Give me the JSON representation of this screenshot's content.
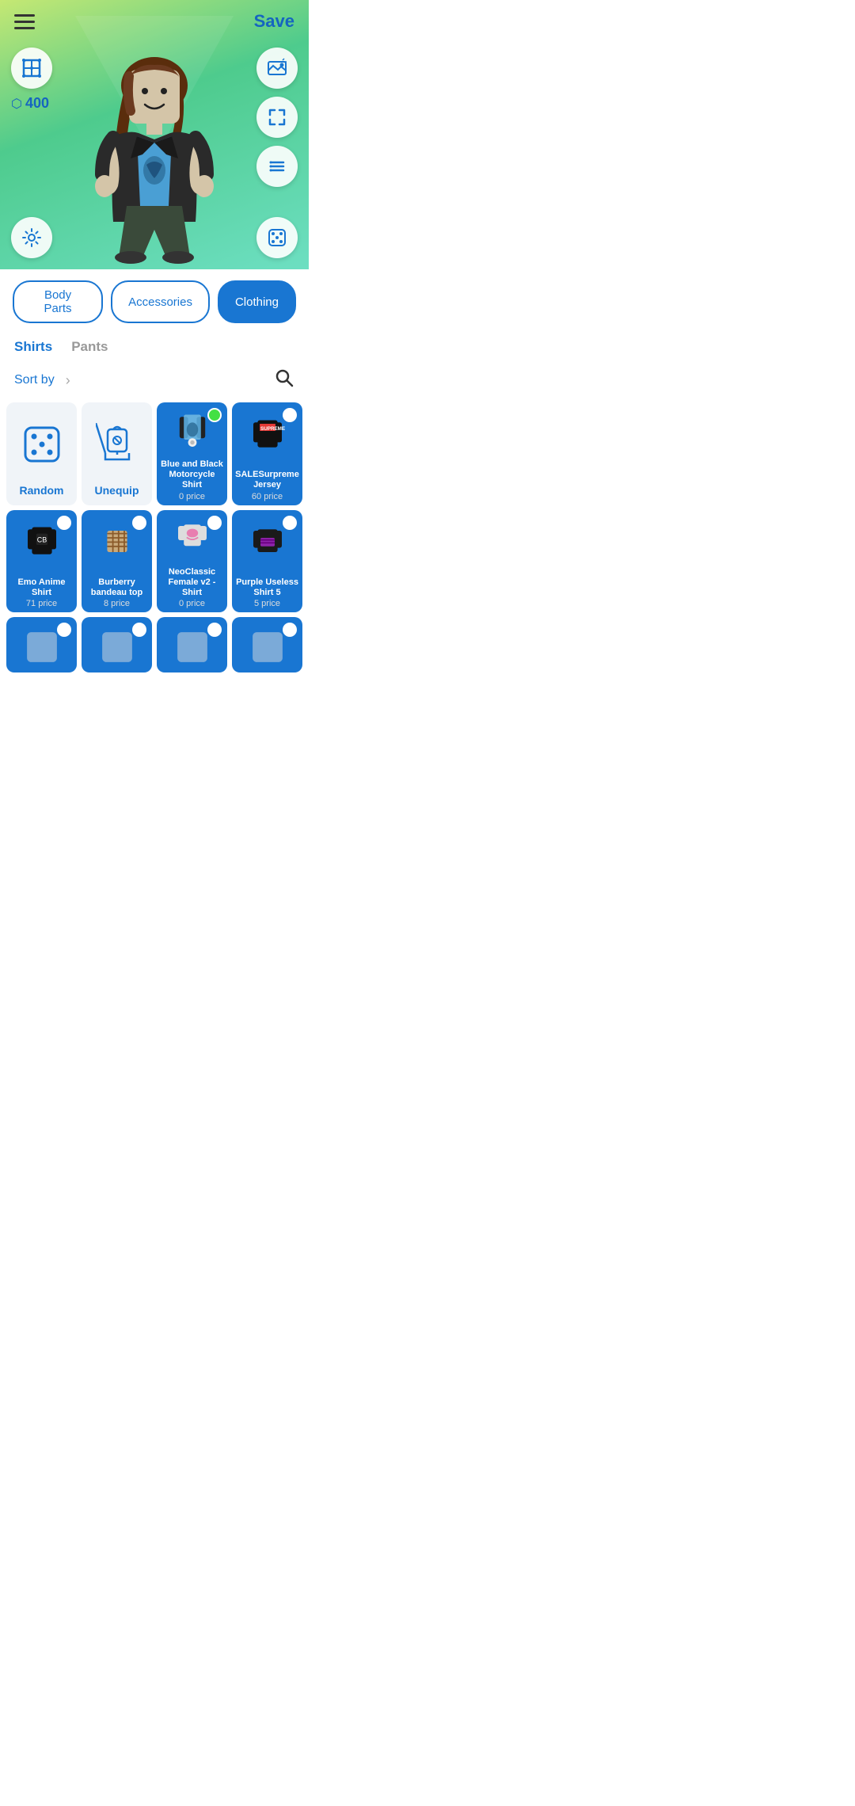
{
  "header": {
    "save_label": "Save",
    "menu_icon": "☰"
  },
  "avatar": {
    "currency_amount": "400",
    "currency_icon": "⬡"
  },
  "category_tabs": [
    {
      "id": "body-parts",
      "label": "Body Parts",
      "active": false
    },
    {
      "id": "accessories",
      "label": "Accessories",
      "active": false
    },
    {
      "id": "clothing",
      "label": "Clothing",
      "active": true
    }
  ],
  "sub_tabs": [
    {
      "id": "shirts",
      "label": "Shirts",
      "active": true
    },
    {
      "id": "pants",
      "label": "Pants",
      "active": false
    }
  ],
  "sort": {
    "label": "Sort by",
    "arrow": "›"
  },
  "items": [
    {
      "id": "random",
      "label": "Random",
      "price": null,
      "bg": "white",
      "selected": false,
      "type": "special"
    },
    {
      "id": "unequip",
      "label": "Unequip",
      "price": null,
      "bg": "white",
      "selected": false,
      "type": "special"
    },
    {
      "id": "blue-black-moto",
      "label": "Blue and Black Motorcycle Shirt",
      "price": "0 price",
      "bg": "blue",
      "selected": true,
      "type": "shirt",
      "price_class": "free"
    },
    {
      "id": "sale-supreme",
      "label": "SALESurpreme Jersey",
      "price": "60 price",
      "bg": "blue",
      "selected": false,
      "type": "shirt"
    },
    {
      "id": "emo-anime",
      "label": "Emo Anime Shirt",
      "price": "71 price",
      "bg": "blue",
      "selected": false,
      "type": "shirt"
    },
    {
      "id": "burberry",
      "label": "Burberry bandeau top",
      "price": "8 price",
      "bg": "blue",
      "selected": false,
      "type": "shirt"
    },
    {
      "id": "neoclassic",
      "label": "NeoClassic Female v2 - Shirt",
      "price": "0 price",
      "bg": "blue",
      "selected": false,
      "type": "shirt",
      "price_class": "free"
    },
    {
      "id": "purple-useless",
      "label": "Purple Useless Shirt 5",
      "price": "5 price",
      "bg": "blue",
      "selected": false,
      "type": "shirt"
    },
    {
      "id": "extra1",
      "label": "",
      "price": "",
      "bg": "blue",
      "selected": false,
      "type": "shirt"
    },
    {
      "id": "extra2",
      "label": "",
      "price": "",
      "bg": "blue",
      "selected": false,
      "type": "shirt"
    },
    {
      "id": "extra3",
      "label": "",
      "price": "",
      "bg": "blue",
      "selected": false,
      "type": "shirt"
    },
    {
      "id": "extra4",
      "label": "",
      "price": "",
      "bg": "blue",
      "selected": false,
      "type": "shirt"
    }
  ]
}
